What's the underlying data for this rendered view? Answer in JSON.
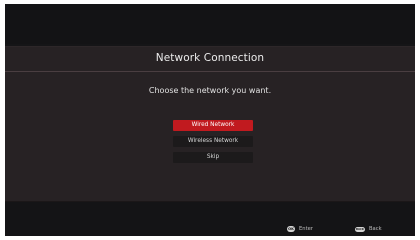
{
  "dialog": {
    "title": "Network Connection",
    "prompt": "Choose the network you want.",
    "options": [
      {
        "label": "Wired Network",
        "selected": true
      },
      {
        "label": "Wireless Network",
        "selected": false
      },
      {
        "label": "Skip",
        "selected": false
      }
    ]
  },
  "footer": {
    "enter": {
      "icon": "ok-button-icon",
      "icon_text": "OK",
      "label": "Enter"
    },
    "back": {
      "icon": "back-button-icon",
      "icon_text": "BACK",
      "label": "Back"
    }
  },
  "colors": {
    "accent": "#c11a1f",
    "panel": "#272224",
    "background": "#151517"
  }
}
